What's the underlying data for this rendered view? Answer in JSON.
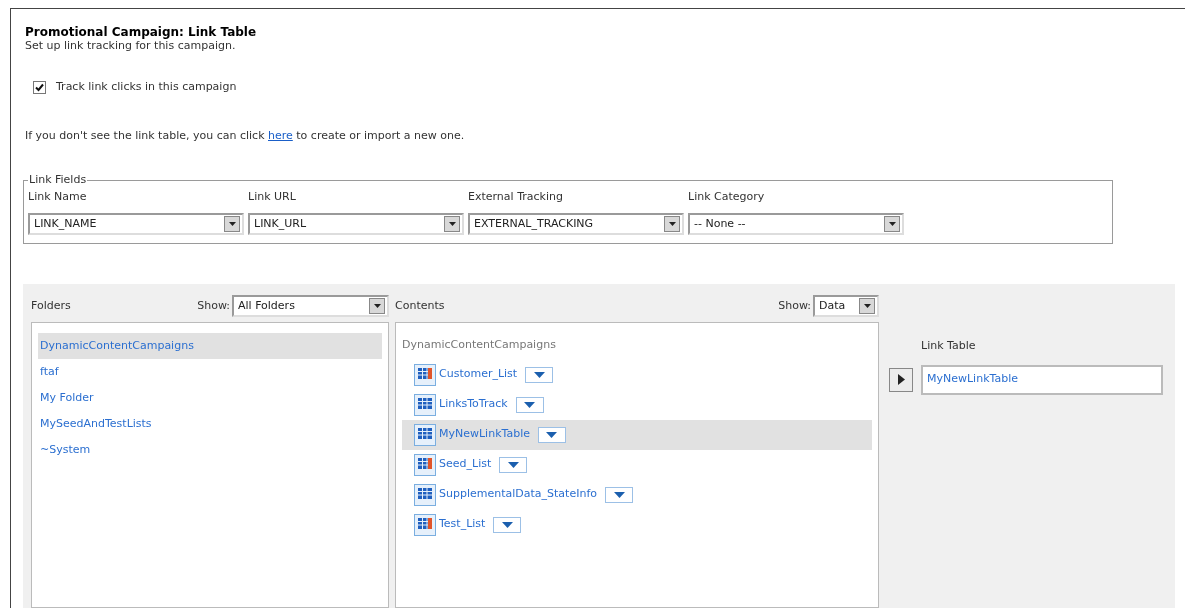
{
  "header": {
    "title": "Promotional Campaign: Link Table",
    "subtitle": "Set up link tracking for this campaign."
  },
  "track_checkbox": {
    "label": "Track link clicks in this campaign",
    "checked": true
  },
  "info": {
    "before": "If you don't see the link table, you can click ",
    "link": "here",
    "after": " to create or import a new one."
  },
  "link_fields": {
    "legend": "Link Fields",
    "fields": [
      {
        "label": "Link Name",
        "value": "LINK_NAME"
      },
      {
        "label": "Link URL",
        "value": "LINK_URL"
      },
      {
        "label": "External Tracking",
        "value": "EXTERNAL_TRACKING"
      },
      {
        "label": "Link Category",
        "value": "-- None --"
      }
    ]
  },
  "folders": {
    "title": "Folders",
    "show_label": "Show:",
    "show_value": "All Folders",
    "items": [
      {
        "label": "DynamicContentCampaigns",
        "selected": true
      },
      {
        "label": "ftaf",
        "selected": false
      },
      {
        "label": "My Folder",
        "selected": false
      },
      {
        "label": "MySeedAndTestLists",
        "selected": false
      },
      {
        "label": "~System",
        "selected": false
      }
    ]
  },
  "contents": {
    "title": "Contents",
    "show_label": "Show:",
    "show_value": "Data",
    "folder": "DynamicContentCampaigns",
    "items": [
      {
        "label": "Customer_List",
        "kind": "list",
        "selected": false
      },
      {
        "label": "LinksToTrack",
        "kind": "table",
        "selected": false
      },
      {
        "label": "MyNewLinkTable",
        "kind": "table",
        "selected": true
      },
      {
        "label": "Seed_List",
        "kind": "list",
        "selected": false
      },
      {
        "label": "SupplementalData_StateInfo",
        "kind": "table",
        "selected": false
      },
      {
        "label": "Test_List",
        "kind": "list",
        "selected": false
      }
    ]
  },
  "link_table": {
    "label": "Link Table",
    "value": "MyNewLinkTable"
  }
}
